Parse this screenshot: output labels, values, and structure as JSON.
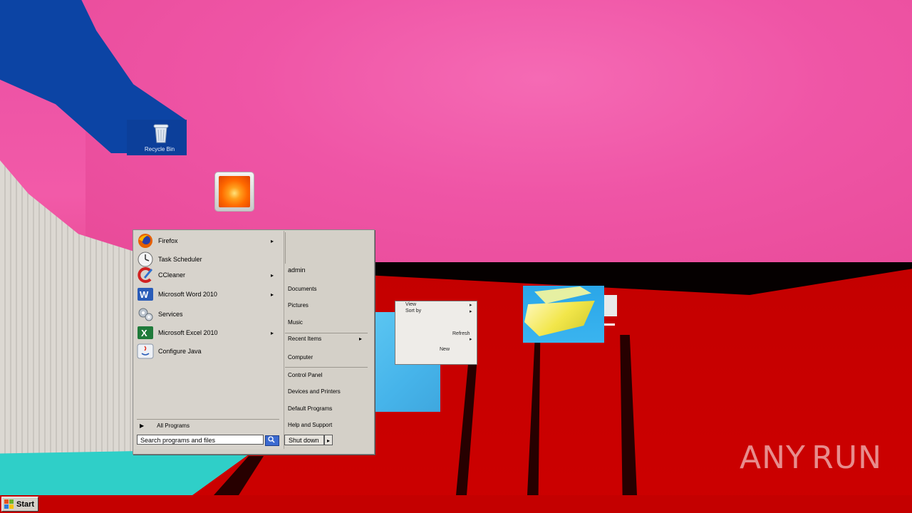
{
  "desktop": {
    "recycle_bin_label": "Recycle Bin"
  },
  "start_menu": {
    "programs": [
      {
        "label": "Firefox",
        "icon": "firefox-icon",
        "has_submenu": true
      },
      {
        "label": "Task Scheduler",
        "icon": "clock-icon",
        "has_submenu": false
      },
      {
        "label": "CCleaner",
        "icon": "ccleaner-icon",
        "has_submenu": true
      },
      {
        "label": "Microsoft Word 2010",
        "icon": "word-icon",
        "has_submenu": true
      },
      {
        "label": "Services",
        "icon": "gears-icon",
        "has_submenu": false
      },
      {
        "label": "Microsoft Excel 2010",
        "icon": "excel-icon",
        "has_submenu": true
      },
      {
        "label": "Configure Java",
        "icon": "java-icon",
        "has_submenu": false
      }
    ],
    "all_programs_label": "All Programs",
    "search_placeholder": "Search programs and files",
    "right_items": [
      {
        "label": "admin"
      },
      {
        "label": "Documents"
      },
      {
        "label": "Pictures"
      },
      {
        "label": "Music"
      },
      {
        "label": "Recent Items",
        "has_submenu": true
      },
      {
        "label": "Computer"
      },
      {
        "label": "Control Panel"
      },
      {
        "label": "Devices and Printers"
      },
      {
        "label": "Default Programs"
      },
      {
        "label": "Help and Support"
      }
    ],
    "shutdown_label": "Shut down",
    "submenu_arrow": "▸"
  },
  "context_fragment": {
    "items": [
      "View",
      "Sort by",
      "Refresh",
      "New"
    ]
  },
  "taskbar": {
    "start_label": "Start"
  },
  "watermark": {
    "text_left": "ANY",
    "text_right": "RUN"
  },
  "colors": {
    "desktop_red": "#c40000",
    "desktop_pink": "#ef55a6",
    "menu_grey": "#d4d0c8"
  }
}
